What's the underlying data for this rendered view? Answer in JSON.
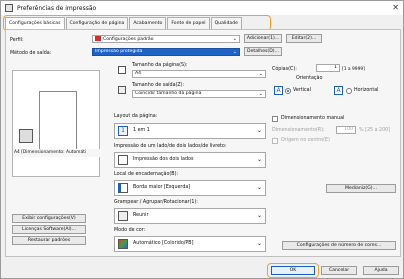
{
  "window": {
    "title": "Preferências de impressão",
    "close_glyph": "✕"
  },
  "tabs": [
    {
      "label": "Configurações básicas"
    },
    {
      "label": "Configuração de página"
    },
    {
      "label": "Acabamento"
    },
    {
      "label": "Fonte de papel"
    },
    {
      "label": "Qualidade"
    }
  ],
  "profile": {
    "label": "Perfil:",
    "value": "Configurações padrão",
    "add_button": "Adicionar(1)...",
    "edit_button": "Editar(2)..."
  },
  "output": {
    "label": "Método de saída:",
    "value": "Impressão protegida",
    "details_button": "Detalhes(D)..."
  },
  "preview": {
    "caption": "A4 [Dimensionamento: Automáti"
  },
  "left_buttons": {
    "view_settings": "Exibir configurações(V)",
    "license": "Licenças Software(Al)...",
    "restore": "Restaurar padrões"
  },
  "page_size": {
    "label": "Tamanho da página(S):",
    "value": "A4"
  },
  "output_size": {
    "label": "Tamanho de saída(Z):",
    "value": "Coincidir tamanho da página"
  },
  "copies": {
    "label": "Cópias(C):",
    "value": "1",
    "range": "[1 a 9999]"
  },
  "orientation": {
    "label": "Orientação",
    "portrait_label": "Vertical",
    "landscape_label": "Horizontal",
    "selected": "portrait"
  },
  "layout": {
    "label": "Layout da página:",
    "value": "1 em 1"
  },
  "manual_scaling": {
    "label": "Dimensionamento manual",
    "scale_label": "Dimensionamento(R):",
    "scale_value": "100",
    "scale_range": "% [25 a 200]",
    "origin_label": "Origem no centro(E)"
  },
  "print_type": {
    "label": "Impressão de um lado/de dois lados/de livreto:",
    "value": "Impressão dos dois lados"
  },
  "binding": {
    "label": "Local de encadernação(B):",
    "value": "Borda maior [Esquerda]",
    "margin_button": "Medianiz(G)..."
  },
  "finishing": {
    "label": "Grampear / Agrupar/Rotacionar(1):",
    "value": "Reunir"
  },
  "color_mode": {
    "label": "Modo de cor:",
    "value": "Automático [Colorido/PB]",
    "color_settings_button": "Configurações de número de cores..."
  },
  "footer": {
    "ok": "OK",
    "cancel": "Cancelar",
    "help": "Ajuda"
  },
  "colors": {
    "accent": "#1a5fc1",
    "highlight": "#f0a030"
  }
}
